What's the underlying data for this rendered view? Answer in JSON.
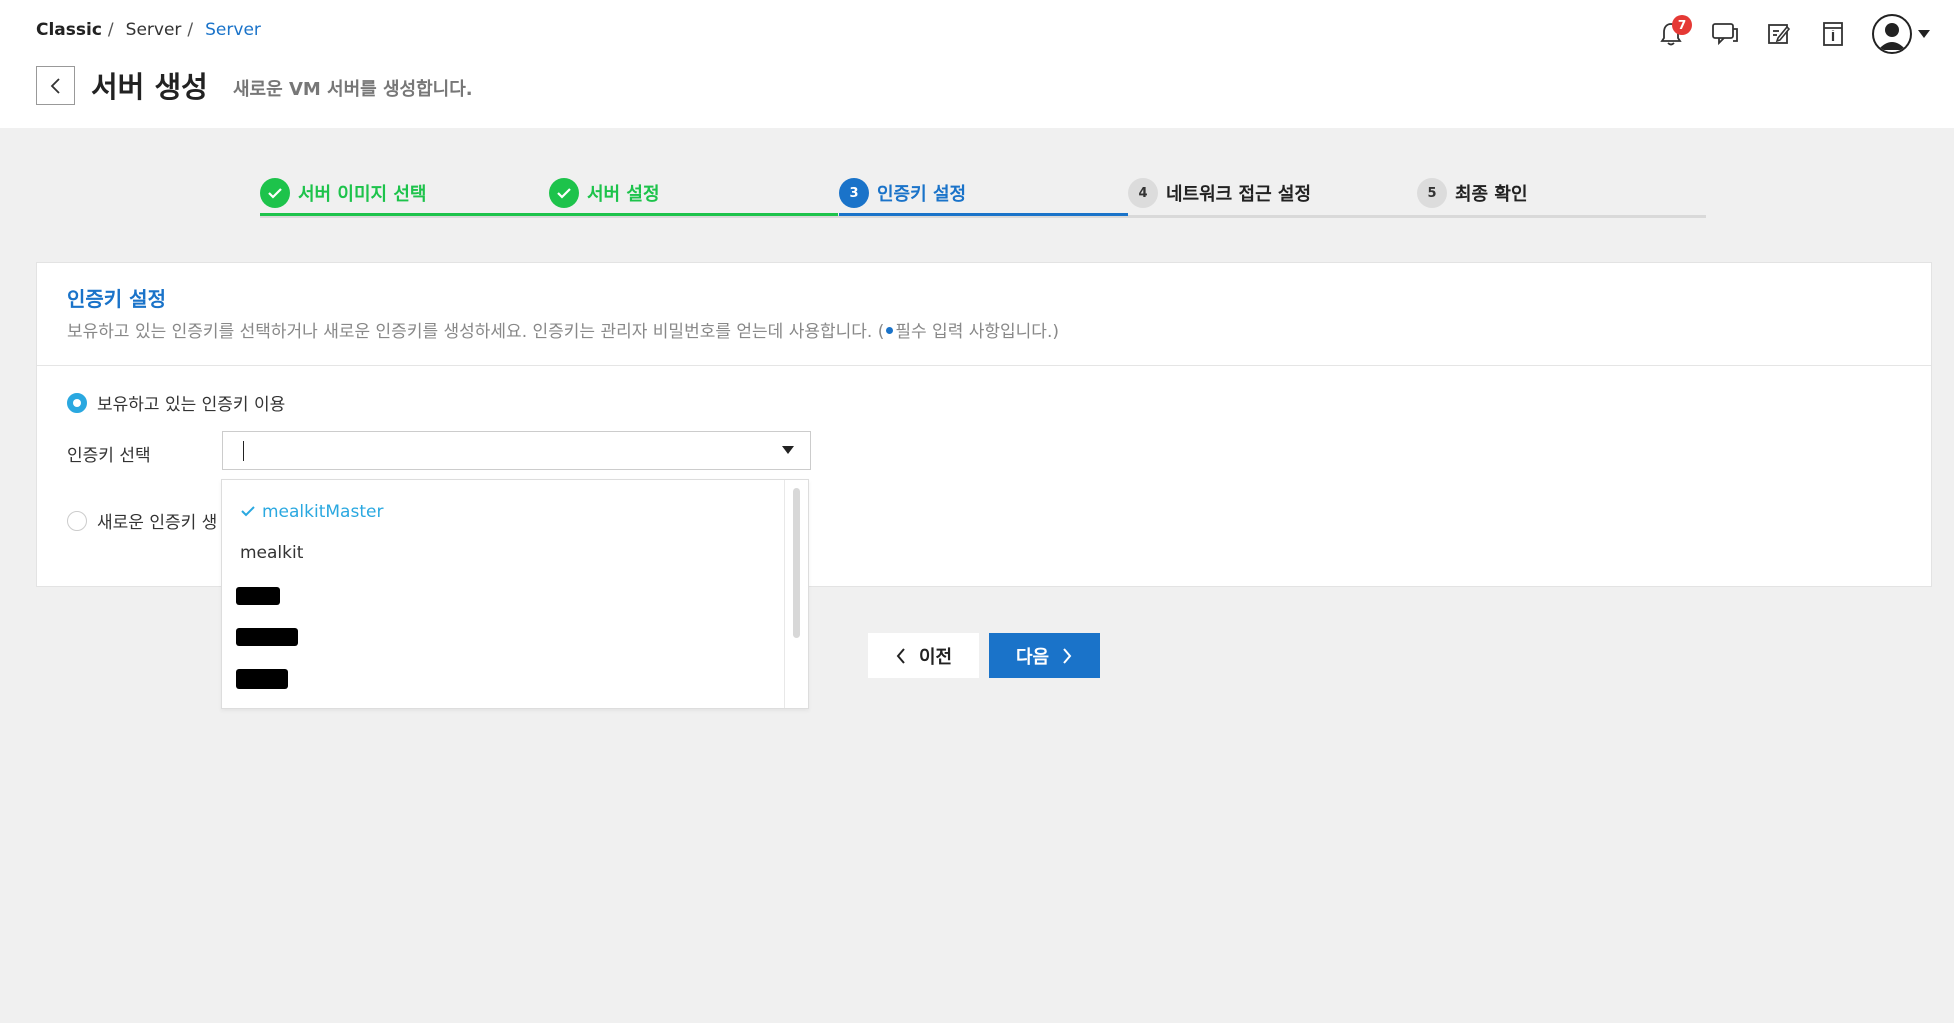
{
  "breadcrumb": {
    "root": "Classic",
    "sep": "/",
    "mid": "Server",
    "current": "Server"
  },
  "header": {
    "title": "서버 생성",
    "subtitle": "새로운 VM 서버를 생성합니다.",
    "notification_count": "7",
    "icons": [
      "bell-icon",
      "chat-icon",
      "edit-note-icon",
      "info-box-icon",
      "user-avatar-icon"
    ]
  },
  "steps": [
    {
      "number": "1",
      "label": "서버 이미지 선택",
      "status": "done"
    },
    {
      "number": "2",
      "label": "서버 설정",
      "status": "done"
    },
    {
      "number": "3",
      "label": "인증키 설정",
      "status": "active"
    },
    {
      "number": "4",
      "label": "네트워크 접근 설정",
      "status": "todo"
    },
    {
      "number": "5",
      "label": "최종 확인",
      "status": "todo"
    }
  ],
  "panel": {
    "title": "인증키 설정",
    "desc_before": "보유하고 있는 인증키를 선택하거나 새로운 인증키를 생성하세요. 인증키는 관리자 비밀번호를 얻는데 사용합니다. (",
    "desc_after": "필수 입력 사항입니다.)",
    "option_existing": "보유하고 있는 인증키 이용",
    "option_new": "새로운 인증키 생",
    "select_label": "인증키 선택",
    "select_value": ""
  },
  "dropdown": {
    "options": [
      "mealkitMaster",
      "mealkit"
    ],
    "selected": "mealkitMaster"
  },
  "buttons": {
    "prev": "이전",
    "next": "다음"
  },
  "colors": {
    "accent": "#1a73c9",
    "done": "#1dc34b",
    "selected": "#2aa8e0",
    "badge": "#e53935"
  }
}
